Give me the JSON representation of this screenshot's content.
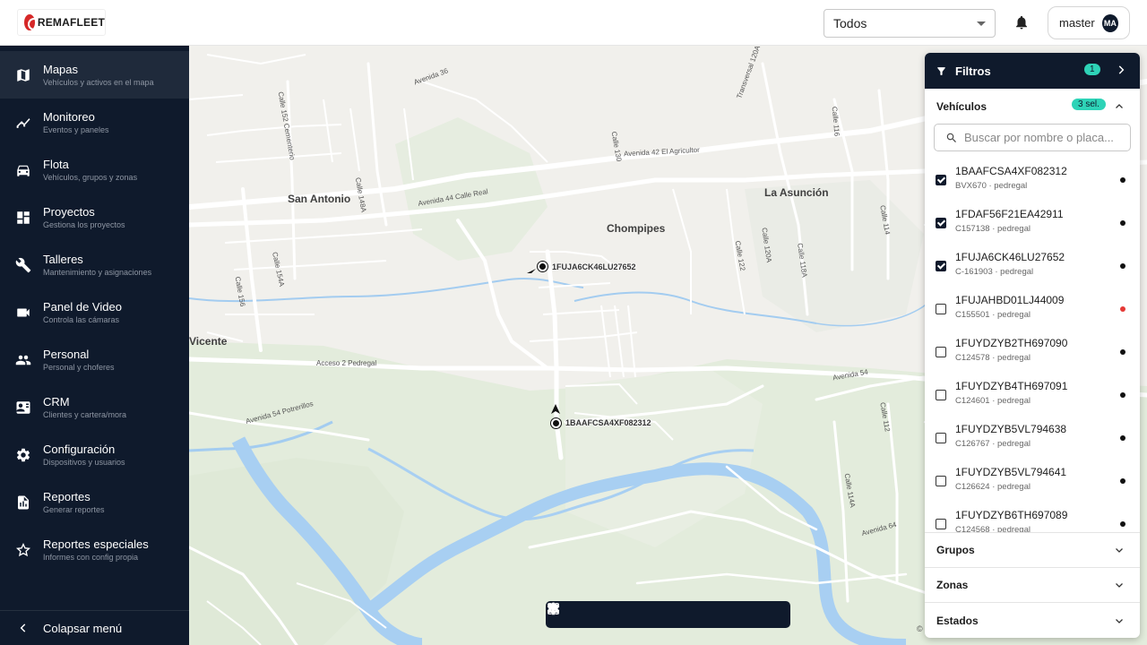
{
  "brand": {
    "logo_text": "REMAFLEET"
  },
  "header": {
    "company_select": "Todos",
    "user_name": "master",
    "user_initials": "MA"
  },
  "sidebar": {
    "items": [
      {
        "title": "Mapas",
        "subtitle": "Vehículos y activos en el mapa",
        "icon": "map-icon",
        "active": true
      },
      {
        "title": "Monitoreo",
        "subtitle": "Eventos y paneles",
        "icon": "timeline-icon"
      },
      {
        "title": "Flota",
        "subtitle": "Vehículos, grupos y zonas",
        "icon": "car-icon"
      },
      {
        "title": "Proyectos",
        "subtitle": "Gestiona los proyectos",
        "icon": "dashboard-icon"
      },
      {
        "title": "Talleres",
        "subtitle": "Mantenimiento y asignaciones",
        "icon": "wrench-icon"
      },
      {
        "title": "Panel de Video",
        "subtitle": "Controla las cámaras",
        "icon": "video-icon"
      },
      {
        "title": "Personal",
        "subtitle": "Personal y choferes",
        "icon": "people-icon"
      },
      {
        "title": "CRM",
        "subtitle": "Clientes y cartera/mora",
        "icon": "contact-card-icon"
      },
      {
        "title": "Configuración",
        "subtitle": "Dispositivos y usuarios",
        "icon": "gear-icon"
      },
      {
        "title": "Reportes",
        "subtitle": "Generar reportes",
        "icon": "report-icon"
      },
      {
        "title": "Reportes especiales",
        "subtitle": "Informes con config propia",
        "icon": "star-icon"
      }
    ],
    "collapse_label": "Colapsar menú"
  },
  "map": {
    "places": [
      "San Antonio",
      "La Asunción",
      "Chompipes",
      "Vicente"
    ],
    "streets": [
      "Avenida 36",
      "Avenida 42 El Agricultor",
      "Avenida 44 Calle Real",
      "Acceso 2 Pedregal",
      "Avenida 54 Potrerillos",
      "Avenida 54",
      "Avenida 64",
      "Calle 152 Cementerio",
      "Calle 130",
      "Calle 116",
      "Calle 114",
      "Calle 122",
      "Calle 120A",
      "Calle 118A",
      "Calle 154A",
      "Calle 156",
      "Calle 148A",
      "Transversal 120A",
      "Calle 112",
      "Calle 114A"
    ],
    "markers": [
      {
        "label": "1FUJA6CK46LU27652"
      },
      {
        "label": "1BAAFCSA4XF082312"
      }
    ],
    "toolbar": [
      "layers-icon",
      "center-focus-icon",
      "zoom-out-icon",
      "zoom-in-icon",
      "fullscreen-icon",
      "settings-icon"
    ],
    "copyright": "©"
  },
  "filters": {
    "title": "Filtros",
    "count": "1",
    "vehicles_label": "Vehículos",
    "vehicles_selected": "3 sel.",
    "search_placeholder": "Buscar por nombre o placa...",
    "vehicles": [
      {
        "name": "1BAAFCSA4XF082312",
        "sub": "BVX670 · pedregal",
        "checked": true,
        "status_color": "#111111"
      },
      {
        "name": "1FDAF56F21EA42911",
        "sub": "C157138 · pedregal",
        "checked": true,
        "status_color": "#111111"
      },
      {
        "name": "1FUJA6CK46LU27652",
        "sub": "C-161903 · pedregal",
        "checked": true,
        "status_color": "#111111"
      },
      {
        "name": "1FUJAHBD01LJ44009",
        "sub": "C155501 · pedregal",
        "checked": false,
        "status_color": "#e53935"
      },
      {
        "name": "1FUYDZYB2TH697090",
        "sub": "C124578 · pedregal",
        "checked": false,
        "status_color": "#111111"
      },
      {
        "name": "1FUYDZYB4TH697091",
        "sub": "C124601 · pedregal",
        "checked": false,
        "status_color": "#111111"
      },
      {
        "name": "1FUYDZYB5VL794638",
        "sub": "C126767 · pedregal",
        "checked": false,
        "status_color": "#111111"
      },
      {
        "name": "1FUYDZYB5VL794641",
        "sub": "C126624 · pedregal",
        "checked": false,
        "status_color": "#111111"
      },
      {
        "name": "1FUYDZYB6TH697089",
        "sub": "C124568 · pedregal",
        "checked": false,
        "status_color": "#111111"
      }
    ],
    "groups_label": "Grupos",
    "zones_label": "Zonas",
    "states_label": "Estados"
  },
  "colors": {
    "sidebar_bg": "#0f1a2c",
    "accent": "#2ed3b7",
    "alert": "#e53935"
  }
}
